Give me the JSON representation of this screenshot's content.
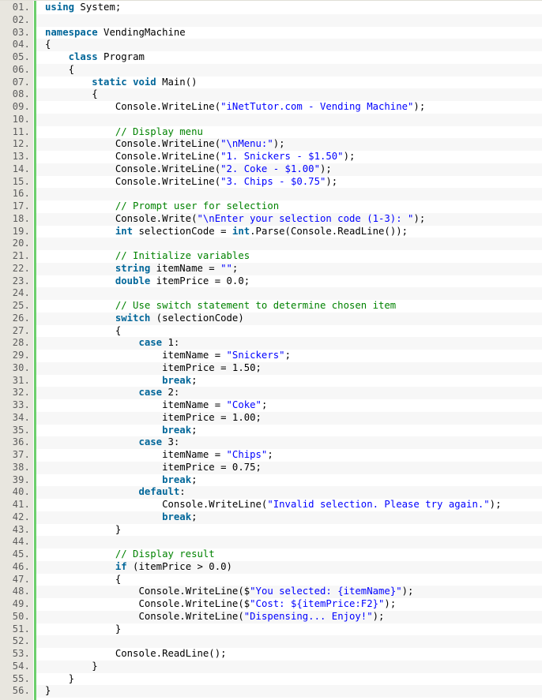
{
  "language": "C#",
  "colors": {
    "keyword": "#006699",
    "string": "#0000ff",
    "comment": "#008200",
    "plain": "#000000",
    "gutter_marker": "#6ccf6c"
  },
  "lines": [
    {
      "n": "01.",
      "indent": 0,
      "tokens": [
        [
          "kw",
          "using"
        ],
        [
          "p",
          " System;"
        ]
      ]
    },
    {
      "n": "02.",
      "indent": 0,
      "tokens": []
    },
    {
      "n": "03.",
      "indent": 0,
      "tokens": [
        [
          "kw",
          "namespace"
        ],
        [
          "p",
          " VendingMachine"
        ]
      ]
    },
    {
      "n": "04.",
      "indent": 0,
      "tokens": [
        [
          "p",
          "{"
        ]
      ]
    },
    {
      "n": "05.",
      "indent": 1,
      "tokens": [
        [
          "kw",
          "class"
        ],
        [
          "p",
          " Program"
        ]
      ]
    },
    {
      "n": "06.",
      "indent": 1,
      "tokens": [
        [
          "p",
          "{"
        ]
      ]
    },
    {
      "n": "07.",
      "indent": 2,
      "tokens": [
        [
          "kw",
          "static"
        ],
        [
          "p",
          " "
        ],
        [
          "kw",
          "void"
        ],
        [
          "p",
          " Main()"
        ]
      ]
    },
    {
      "n": "08.",
      "indent": 2,
      "tokens": [
        [
          "p",
          "{"
        ]
      ]
    },
    {
      "n": "09.",
      "indent": 3,
      "tokens": [
        [
          "p",
          "Console.WriteLine("
        ],
        [
          "str",
          "\"iNetTutor.com - Vending Machine\""
        ],
        [
          "p",
          ");"
        ]
      ]
    },
    {
      "n": "10.",
      "indent": 0,
      "tokens": []
    },
    {
      "n": "11.",
      "indent": 3,
      "tokens": [
        [
          "cm",
          "// Display menu"
        ]
      ]
    },
    {
      "n": "12.",
      "indent": 3,
      "tokens": [
        [
          "p",
          "Console.WriteLine("
        ],
        [
          "str",
          "\"\\nMenu:\""
        ],
        [
          "p",
          ");"
        ]
      ]
    },
    {
      "n": "13.",
      "indent": 3,
      "tokens": [
        [
          "p",
          "Console.WriteLine("
        ],
        [
          "str",
          "\"1. Snickers - $1.50\""
        ],
        [
          "p",
          ");"
        ]
      ]
    },
    {
      "n": "14.",
      "indent": 3,
      "tokens": [
        [
          "p",
          "Console.WriteLine("
        ],
        [
          "str",
          "\"2. Coke - $1.00\""
        ],
        [
          "p",
          ");"
        ]
      ]
    },
    {
      "n": "15.",
      "indent": 3,
      "tokens": [
        [
          "p",
          "Console.WriteLine("
        ],
        [
          "str",
          "\"3. Chips - $0.75\""
        ],
        [
          "p",
          ");"
        ]
      ]
    },
    {
      "n": "16.",
      "indent": 0,
      "tokens": []
    },
    {
      "n": "17.",
      "indent": 3,
      "tokens": [
        [
          "cm",
          "// Prompt user for selection"
        ]
      ]
    },
    {
      "n": "18.",
      "indent": 3,
      "tokens": [
        [
          "p",
          "Console.Write("
        ],
        [
          "str",
          "\"\\nEnter your selection code (1-3): \""
        ],
        [
          "p",
          ");"
        ]
      ]
    },
    {
      "n": "19.",
      "indent": 3,
      "tokens": [
        [
          "kw",
          "int"
        ],
        [
          "p",
          " selectionCode = "
        ],
        [
          "kw",
          "int"
        ],
        [
          "p",
          ".Parse(Console.ReadLine());"
        ]
      ]
    },
    {
      "n": "20.",
      "indent": 0,
      "tokens": []
    },
    {
      "n": "21.",
      "indent": 3,
      "tokens": [
        [
          "cm",
          "// Initialize variables"
        ]
      ]
    },
    {
      "n": "22.",
      "indent": 3,
      "tokens": [
        [
          "kw",
          "string"
        ],
        [
          "p",
          " itemName = "
        ],
        [
          "str",
          "\"\""
        ],
        [
          "p",
          ";"
        ]
      ]
    },
    {
      "n": "23.",
      "indent": 3,
      "tokens": [
        [
          "kw",
          "double"
        ],
        [
          "p",
          " itemPrice = 0.0;"
        ]
      ]
    },
    {
      "n": "24.",
      "indent": 0,
      "tokens": []
    },
    {
      "n": "25.",
      "indent": 3,
      "tokens": [
        [
          "cm",
          "// Use switch statement to determine chosen item"
        ]
      ]
    },
    {
      "n": "26.",
      "indent": 3,
      "tokens": [
        [
          "kw",
          "switch"
        ],
        [
          "p",
          " (selectionCode)"
        ]
      ]
    },
    {
      "n": "27.",
      "indent": 3,
      "tokens": [
        [
          "p",
          "{"
        ]
      ]
    },
    {
      "n": "28.",
      "indent": 4,
      "tokens": [
        [
          "kw",
          "case"
        ],
        [
          "p",
          " 1:"
        ]
      ]
    },
    {
      "n": "29.",
      "indent": 5,
      "tokens": [
        [
          "p",
          "itemName = "
        ],
        [
          "str",
          "\"Snickers\""
        ],
        [
          "p",
          ";"
        ]
      ]
    },
    {
      "n": "30.",
      "indent": 5,
      "tokens": [
        [
          "p",
          "itemPrice = 1.50;"
        ]
      ]
    },
    {
      "n": "31.",
      "indent": 5,
      "tokens": [
        [
          "kw",
          "break"
        ],
        [
          "p",
          ";"
        ]
      ]
    },
    {
      "n": "32.",
      "indent": 4,
      "tokens": [
        [
          "kw",
          "case"
        ],
        [
          "p",
          " 2:"
        ]
      ]
    },
    {
      "n": "33.",
      "indent": 5,
      "tokens": [
        [
          "p",
          "itemName = "
        ],
        [
          "str",
          "\"Coke\""
        ],
        [
          "p",
          ";"
        ]
      ]
    },
    {
      "n": "34.",
      "indent": 5,
      "tokens": [
        [
          "p",
          "itemPrice = 1.00;"
        ]
      ]
    },
    {
      "n": "35.",
      "indent": 5,
      "tokens": [
        [
          "kw",
          "break"
        ],
        [
          "p",
          ";"
        ]
      ]
    },
    {
      "n": "36.",
      "indent": 4,
      "tokens": [
        [
          "kw",
          "case"
        ],
        [
          "p",
          " 3:"
        ]
      ]
    },
    {
      "n": "37.",
      "indent": 5,
      "tokens": [
        [
          "p",
          "itemName = "
        ],
        [
          "str",
          "\"Chips\""
        ],
        [
          "p",
          ";"
        ]
      ]
    },
    {
      "n": "38.",
      "indent": 5,
      "tokens": [
        [
          "p",
          "itemPrice = 0.75;"
        ]
      ]
    },
    {
      "n": "39.",
      "indent": 5,
      "tokens": [
        [
          "kw",
          "break"
        ],
        [
          "p",
          ";"
        ]
      ]
    },
    {
      "n": "40.",
      "indent": 4,
      "tokens": [
        [
          "kw",
          "default"
        ],
        [
          "p",
          ":"
        ]
      ]
    },
    {
      "n": "41.",
      "indent": 5,
      "tokens": [
        [
          "p",
          "Console.WriteLine("
        ],
        [
          "str",
          "\"Invalid selection. Please try again.\""
        ],
        [
          "p",
          ");"
        ]
      ]
    },
    {
      "n": "42.",
      "indent": 5,
      "tokens": [
        [
          "kw",
          "break"
        ],
        [
          "p",
          ";"
        ]
      ]
    },
    {
      "n": "43.",
      "indent": 3,
      "tokens": [
        [
          "p",
          "}"
        ]
      ]
    },
    {
      "n": "44.",
      "indent": 0,
      "tokens": []
    },
    {
      "n": "45.",
      "indent": 3,
      "tokens": [
        [
          "cm",
          "// Display result"
        ]
      ]
    },
    {
      "n": "46.",
      "indent": 3,
      "tokens": [
        [
          "kw",
          "if"
        ],
        [
          "p",
          " (itemPrice > 0.0)"
        ]
      ]
    },
    {
      "n": "47.",
      "indent": 3,
      "tokens": [
        [
          "p",
          "{"
        ]
      ]
    },
    {
      "n": "48.",
      "indent": 4,
      "tokens": [
        [
          "p",
          "Console.WriteLine($"
        ],
        [
          "str",
          "\"You selected: {itemName}\""
        ],
        [
          "p",
          ");"
        ]
      ]
    },
    {
      "n": "49.",
      "indent": 4,
      "tokens": [
        [
          "p",
          "Console.WriteLine($"
        ],
        [
          "str",
          "\"Cost: ${itemPrice:F2}\""
        ],
        [
          "p",
          ");"
        ]
      ]
    },
    {
      "n": "50.",
      "indent": 4,
      "tokens": [
        [
          "p",
          "Console.WriteLine("
        ],
        [
          "str",
          "\"Dispensing... Enjoy!\""
        ],
        [
          "p",
          ");"
        ]
      ]
    },
    {
      "n": "51.",
      "indent": 3,
      "tokens": [
        [
          "p",
          "}"
        ]
      ]
    },
    {
      "n": "52.",
      "indent": 0,
      "tokens": []
    },
    {
      "n": "53.",
      "indent": 3,
      "tokens": [
        [
          "p",
          "Console.ReadLine();"
        ]
      ]
    },
    {
      "n": "54.",
      "indent": 2,
      "tokens": [
        [
          "p",
          "}"
        ]
      ]
    },
    {
      "n": "55.",
      "indent": 1,
      "tokens": [
        [
          "p",
          "}"
        ]
      ]
    },
    {
      "n": "56.",
      "indent": 0,
      "tokens": [
        [
          "p",
          "}"
        ]
      ]
    }
  ]
}
